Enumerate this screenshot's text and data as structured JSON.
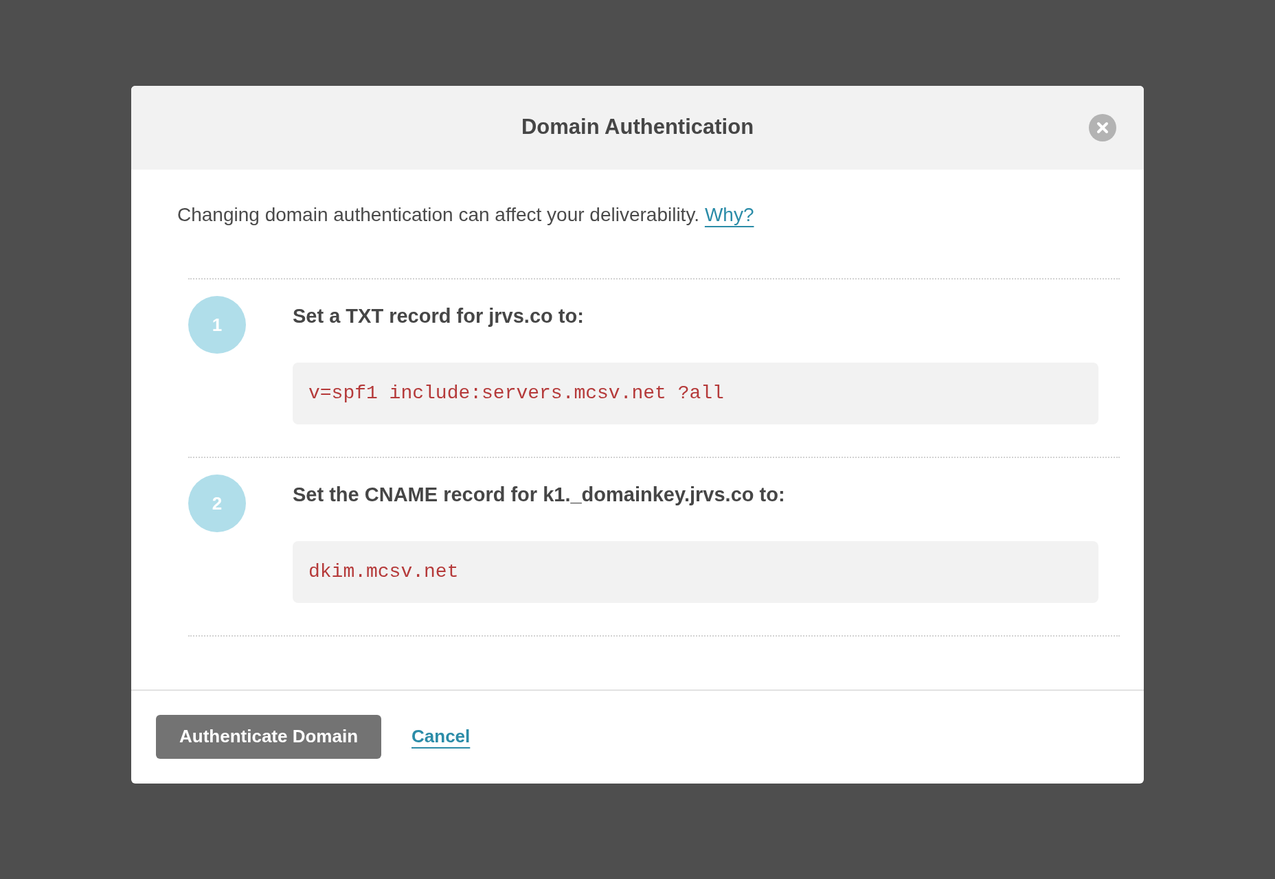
{
  "dialog": {
    "title": "Domain Authentication"
  },
  "notice": {
    "text": "Changing domain authentication can affect your deliverability.",
    "link": "Why?"
  },
  "steps": [
    {
      "number": "1",
      "instruction": "Set a TXT record for jrvs.co to:",
      "value": "v=spf1 include:servers.mcsv.net ?all"
    },
    {
      "number": "2",
      "instruction": "Set the CNAME record for k1._domainkey.jrvs.co to:",
      "value": "dkim.mcsv.net"
    }
  ],
  "footer": {
    "primary_button": "Authenticate Domain",
    "cancel_link": "Cancel"
  }
}
